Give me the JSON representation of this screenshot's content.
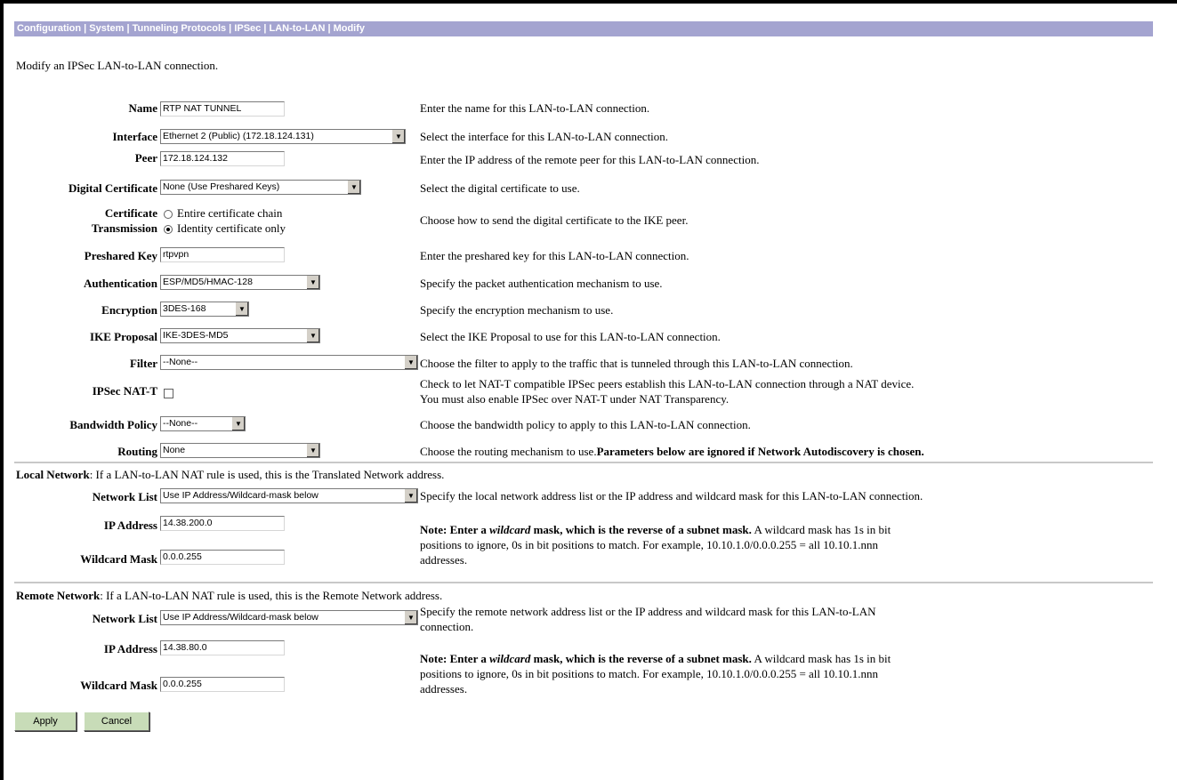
{
  "breadcrumb": "Configuration | System | Tunneling Protocols | IPSec | LAN-to-LAN | Modify",
  "intro": "Modify an IPSec LAN-to-LAN connection.",
  "fields": {
    "name": {
      "label": "Name",
      "value": "RTP NAT TUNNEL",
      "desc": "Enter the name for this LAN-to-LAN connection."
    },
    "interface": {
      "label": "Interface",
      "value": "Ethernet 2 (Public) (172.18.124.131)",
      "desc": "Select the interface for this LAN-to-LAN connection."
    },
    "peer": {
      "label": "Peer",
      "value": "172.18.124.132",
      "desc": "Enter the IP address of the remote peer for this LAN-to-LAN connection."
    },
    "digital_certificate": {
      "label": "Digital Certificate",
      "value": "None (Use Preshared Keys)",
      "desc": "Select the digital certificate to use."
    },
    "certificate_transmission": {
      "label_line1": "Certificate",
      "label_line2": "Transmission",
      "option1": "Entire certificate chain",
      "option2": "Identity certificate only",
      "selected": "Identity certificate only",
      "desc": "Choose how to send the digital certificate to the IKE peer."
    },
    "preshared_key": {
      "label": "Preshared Key",
      "value": "rtpvpn",
      "desc": "Enter the preshared key for this LAN-to-LAN connection."
    },
    "authentication": {
      "label": "Authentication",
      "value": "ESP/MD5/HMAC-128",
      "desc": "Specify the packet authentication mechanism to use."
    },
    "encryption": {
      "label": "Encryption",
      "value": "3DES-168",
      "desc": "Specify the encryption mechanism to use."
    },
    "ike_proposal": {
      "label": "IKE Proposal",
      "value": "IKE-3DES-MD5",
      "desc": "Select the IKE Proposal to use for this LAN-to-LAN connection."
    },
    "filter": {
      "label": "Filter",
      "value": "--None--",
      "desc": "Choose the filter to apply to the traffic that is tunneled through this LAN-to-LAN connection."
    },
    "ipsec_natt": {
      "label": "IPSec NAT-T",
      "checked": false,
      "desc_line1": "Check to let NAT-T compatible IPSec peers establish this LAN-to-LAN connection through a NAT device.",
      "desc_line2": "You must also enable IPSec over NAT-T under NAT Transparency."
    },
    "bandwidth_policy": {
      "label": "Bandwidth Policy",
      "value": "--None--",
      "desc": "Choose the bandwidth policy to apply to this LAN-to-LAN connection."
    },
    "routing": {
      "label": "Routing",
      "value": "None",
      "desc": "Choose the routing mechanism to use.",
      "desc_bold": "Parameters below are ignored if Network Autodiscovery is chosen."
    }
  },
  "local_network": {
    "heading": "Local Network",
    "heading_rest": ": If a LAN-to-LAN NAT rule is used, this is the Translated Network address.",
    "network_list": {
      "label": "Network List",
      "value": "Use IP Address/Wildcard-mask below",
      "desc": "Specify the local network address list or the IP address and wildcard mask for this LAN-to-LAN connection."
    },
    "ip_address": {
      "label": "IP Address",
      "value": "14.38.200.0"
    },
    "wildcard_mask": {
      "label": "Wildcard Mask",
      "value": "0.0.0.255"
    },
    "note_bold": "Note: Enter a ",
    "note_italic": "wildcard",
    "note_bold2": " mask, which is the reverse of a subnet mask.",
    "note_rest1": " A wildcard mask has 1s in bit",
    "note_line2": "positions to ignore, 0s in bit positions to match. For example, 10.10.1.0/0.0.0.255 = all 10.10.1.nnn",
    "note_line3": "addresses."
  },
  "remote_network": {
    "heading": "Remote Network",
    "heading_rest": ": If a LAN-to-LAN NAT rule is used, this is the Remote Network address.",
    "network_list": {
      "label": "Network List",
      "value": "Use IP Address/Wildcard-mask below",
      "desc_line1": "Specify the remote network address list or the IP address and wildcard mask for this LAN-to-LAN",
      "desc_line2": "connection."
    },
    "ip_address": {
      "label": "IP Address",
      "value": "14.38.80.0"
    },
    "wildcard_mask": {
      "label": "Wildcard Mask",
      "value": "0.0.0.255"
    },
    "note_bold": "Note: Enter a ",
    "note_italic": "wildcard",
    "note_bold2": " mask, which is the reverse of a subnet mask.",
    "note_rest1": " A wildcard mask has 1s in bit",
    "note_line2": "positions to ignore, 0s in bit positions to match. For example, 10.10.1.0/0.0.0.255 = all 10.10.1.nnn",
    "note_line3": "addresses."
  },
  "buttons": {
    "apply": "Apply",
    "cancel": "Cancel"
  },
  "colors": {
    "breadcrumb_bg": "#a4a4d0",
    "button_bg": "#c8dcb8"
  }
}
